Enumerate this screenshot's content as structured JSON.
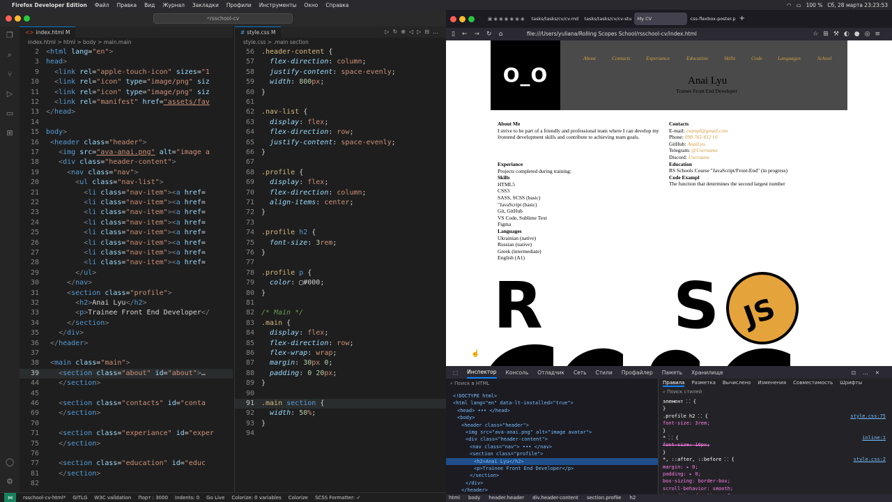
{
  "menubar": {
    "app": "Firefox Developer Edition",
    "items": [
      "Файл",
      "Правка",
      "Вид",
      "Журнал",
      "Закладки",
      "Профили",
      "Инструменты",
      "Окно",
      "Справка"
    ],
    "status_right": [
      "100 %",
      "Сб, 28 марта  23:23:53"
    ]
  },
  "vscode": {
    "search": "rsschool-cv",
    "left_tab": "index.html M",
    "left_crumbs": "index.html > html > body > main.main",
    "right_tab": "style.css M",
    "right_crumbs": "style.css > .main section",
    "html_lines": [
      {
        "n": "2",
        "html": "<span class='p'>&lt;</span><span class='t'>html</span> <span class='a'>lang</span><span class='w'>=</span><span class='s'>\"en\"</span><span class='p'>&gt;</span>"
      },
      {
        "n": "3",
        "html": "<span class='t'>head</span><span class='p'>&gt;</span>"
      },
      {
        "n": "9",
        "html": "  <span class='p'>&lt;</span><span class='t'>link</span> <span class='a'>rel</span><span class='w'>=</span><span class='s'>\"apple-touch-icon\"</span> <span class='a'>sizes</span><span class='w'>=</span><span class='s'>\"1</span>"
      },
      {
        "n": "10",
        "html": "  <span class='p'>&lt;</span><span class='t'>link</span> <span class='a'>rel</span><span class='w'>=</span><span class='s'>\"icon\"</span> <span class='a'>type</span><span class='w'>=</span><span class='s'>\"image/png\"</span> <span class='a'>siz</span>"
      },
      {
        "n": "11",
        "html": "  <span class='p'>&lt;</span><span class='t'>link</span> <span class='a'>rel</span><span class='w'>=</span><span class='s'>\"icon\"</span> <span class='a'>type</span><span class='w'>=</span><span class='s'>\"image/png\"</span> <span class='a'>siz</span>"
      },
      {
        "n": "12",
        "html": "  <span class='p'>&lt;</span><span class='t'>link</span> <span class='a'>rel</span><span class='w'>=</span><span class='s'>\"manifest\"</span> <span class='a'>href</span><span class='w'>=</span><span class='u'>\"assets/fav</span>"
      },
      {
        "n": "13",
        "html": "<span class='p'>&lt;/</span><span class='t'>head</span><span class='p'>&gt;</span>"
      },
      {
        "n": "14",
        "html": ""
      },
      {
        "n": "15",
        "html": "<span class='t'>body</span><span class='p'>&gt;</span>"
      },
      {
        "n": "16",
        "html": " <span class='p'>&lt;</span><span class='t'>header</span> <span class='a'>class</span><span class='w'>=</span><span class='s'>\"header\"</span><span class='p'>&gt;</span>"
      },
      {
        "n": "17",
        "html": "   <span class='p'>&lt;</span><span class='t'>img</span> <span class='a'>src</span><span class='w'>=</span><span class='u'>\"ava-anai.png\"</span> <span class='a'>alt</span><span class='w'>=</span><span class='s'>\"image a</span>"
      },
      {
        "n": "18",
        "html": "   <span class='p'>&lt;</span><span class='t'>div</span> <span class='a'>class</span><span class='w'>=</span><span class='s'>\"header-content\"</span><span class='p'>&gt;</span>"
      },
      {
        "n": "19",
        "html": "     <span class='p'>&lt;</span><span class='t'>nav</span> <span class='a'>class</span><span class='w'>=</span><span class='s'>\"nav\"</span><span class='p'>&gt;</span>"
      },
      {
        "n": "20",
        "html": "       <span class='p'>&lt;</span><span class='t'>ul</span> <span class='a'>class</span><span class='w'>=</span><span class='s'>\"nav-list\"</span><span class='p'>&gt;</span>"
      },
      {
        "n": "21",
        "html": "         <span class='p'>&lt;</span><span class='t'>li</span> <span class='a'>class</span><span class='w'>=</span><span class='s'>\"nav-item\"</span><span class='p'>&gt;&lt;</span><span class='t'>a</span> <span class='a'>href</span><span class='w'>=</span>"
      },
      {
        "n": "22",
        "html": "         <span class='p'>&lt;</span><span class='t'>li</span> <span class='a'>class</span><span class='w'>=</span><span class='s'>\"nav-item\"</span><span class='p'>&gt;&lt;</span><span class='t'>a</span> <span class='a'>href</span><span class='w'>=</span>"
      },
      {
        "n": "23",
        "html": "         <span class='p'>&lt;</span><span class='t'>li</span> <span class='a'>class</span><span class='w'>=</span><span class='s'>\"nav-item\"</span><span class='p'>&gt;&lt;</span><span class='t'>a</span> <span class='a'>href</span><span class='w'>=</span>"
      },
      {
        "n": "24",
        "html": "         <span class='p'>&lt;</span><span class='t'>li</span> <span class='a'>class</span><span class='w'>=</span><span class='s'>\"nav-item\"</span><span class='p'>&gt;&lt;</span><span class='t'>a</span> <span class='a'>href</span><span class='w'>=</span>"
      },
      {
        "n": "25",
        "html": "         <span class='p'>&lt;</span><span class='t'>li</span> <span class='a'>class</span><span class='w'>=</span><span class='s'>\"nav-item\"</span><span class='p'>&gt;&lt;</span><span class='t'>a</span> <span class='a'>href</span><span class='w'>=</span>"
      },
      {
        "n": "26",
        "html": "         <span class='p'>&lt;</span><span class='t'>li</span> <span class='a'>class</span><span class='w'>=</span><span class='s'>\"nav-item\"</span><span class='p'>&gt;&lt;</span><span class='t'>a</span> <span class='a'>href</span><span class='w'>=</span>"
      },
      {
        "n": "27",
        "html": "         <span class='p'>&lt;</span><span class='t'>li</span> <span class='a'>class</span><span class='w'>=</span><span class='s'>\"nav-item\"</span><span class='p'>&gt;&lt;</span><span class='t'>a</span> <span class='a'>href</span><span class='w'>=</span>"
      },
      {
        "n": "28",
        "html": "         <span class='p'>&lt;</span><span class='t'>li</span> <span class='a'>class</span><span class='w'>=</span><span class='s'>\"nav-item\"</span><span class='p'>&gt;&lt;</span><span class='t'>a</span> <span class='a'>href</span><span class='w'>=</span>"
      },
      {
        "n": "29",
        "html": "       <span class='p'>&lt;/</span><span class='t'>ul</span><span class='p'>&gt;</span>"
      },
      {
        "n": "30",
        "html": "     <span class='p'>&lt;/</span><span class='t'>nav</span><span class='p'>&gt;</span>"
      },
      {
        "n": "31",
        "html": "     <span class='p'>&lt;</span><span class='t'>section</span> <span class='a'>class</span><span class='w'>=</span><span class='s'>\"profile\"</span><span class='p'>&gt;</span>"
      },
      {
        "n": "32",
        "html": "       <span class='p'>&lt;</span><span class='t'>h2</span><span class='p'>&gt;</span><span class='w'>Anai Lyu</span><span class='p'>&lt;/</span><span class='t'>h2</span><span class='p'>&gt;</span>"
      },
      {
        "n": "33",
        "html": "       <span class='p'>&lt;</span><span class='t'>p</span><span class='p'>&gt;</span><span class='w'>Trainee Front End Developer</span><span class='p'>&lt;/</span>"
      },
      {
        "n": "34",
        "html": "     <span class='p'>&lt;/</span><span class='t'>section</span><span class='p'>&gt;</span>"
      },
      {
        "n": "35",
        "html": "   <span class='p'>&lt;/</span><span class='t'>div</span><span class='p'>&gt;</span>"
      },
      {
        "n": "36",
        "html": " <span class='p'>&lt;/</span><span class='t'>header</span><span class='p'>&gt;</span>"
      },
      {
        "n": "37",
        "html": ""
      },
      {
        "n": "38",
        "html": " <span class='p'>&lt;</span><span class='t'>main</span> <span class='a'>class</span><span class='w'>=</span><span class='s'>\"main\"</span><span class='p'>&gt;</span>"
      },
      {
        "n": "39",
        "html": "   <span class='p'>&lt;</span><span class='t'>section</span> <span class='a'>class</span><span class='w'>=</span><span class='s'>\"about\"</span> <span class='a'>id</span><span class='w'>=</span><span class='s'>\"about\"</span><span class='p'>&gt;</span><span class='w'>…</span>"
      },
      {
        "n": "44",
        "html": "   <span class='p'>&lt;/</span><span class='t'>section</span><span class='p'>&gt;</span>"
      },
      {
        "n": "45",
        "html": ""
      },
      {
        "n": "46",
        "html": "   <span class='p'>&lt;</span><span class='t'>section</span> <span class='a'>class</span><span class='w'>=</span><span class='s'>\"contacts\"</span> <span class='a'>id</span><span class='w'>=</span><span class='s'>\"conta</span>"
      },
      {
        "n": "69",
        "html": "   <span class='p'>&lt;/</span><span class='t'>section</span><span class='p'>&gt;</span>"
      },
      {
        "n": "70",
        "html": ""
      },
      {
        "n": "71",
        "html": "   <span class='p'>&lt;</span><span class='t'>section</span> <span class='a'>class</span><span class='w'>=</span><span class='s'>\"experiance\"</span> <span class='a'>id</span><span class='w'>=</span><span class='s'>\"exper</span>"
      },
      {
        "n": "75",
        "html": "   <span class='p'>&lt;/</span><span class='t'>section</span><span class='p'>&gt;</span>"
      },
      {
        "n": "76",
        "html": ""
      },
      {
        "n": "77",
        "html": "   <span class='p'>&lt;</span><span class='t'>section</span> <span class='a'>class</span><span class='w'>=</span><span class='s'>\"education\"</span> <span class='a'>id</span><span class='w'>=</span><span class='s'>\"educ</span>"
      },
      {
        "n": "81",
        "html": "   <span class='p'>&lt;/</span><span class='t'>section</span><span class='p'>&gt;</span>"
      },
      {
        "n": "82",
        "html": ""
      }
    ],
    "css_lines": [
      {
        "n": "56",
        "html": "<span class='y'>.header-content</span> <span class='w'>{</span>"
      },
      {
        "n": "57",
        "html": "  <span class='pr'>flex-direction</span><span class='w'>: </span><span class='k'>column</span><span class='w'>;</span>"
      },
      {
        "n": "58",
        "html": "  <span class='pr'>justify-content</span><span class='w'>: </span><span class='k'>space-evenly</span><span class='w'>;</span>"
      },
      {
        "n": "59",
        "html": "  <span class='pr'>width</span><span class='w'>: </span><span class='v'>800</span><span class='k'>px</span><span class='w'>;</span>"
      },
      {
        "n": "60",
        "html": "<span class='w'>}</span>"
      },
      {
        "n": "61",
        "html": ""
      },
      {
        "n": "62",
        "html": "<span class='y'>.nav-list</span> <span class='w'>{</span>"
      },
      {
        "n": "63",
        "html": "  <span class='pr'>display</span><span class='w'>: </span><span class='k'>flex</span><span class='w'>;</span>"
      },
      {
        "n": "64",
        "html": "  <span class='pr'>flex-direction</span><span class='w'>: </span><span class='k'>row</span><span class='w'>;</span>"
      },
      {
        "n": "65",
        "html": "  <span class='pr'>justify-content</span><span class='w'>: </span><span class='k'>space-evenly</span><span class='w'>;</span>"
      },
      {
        "n": "66",
        "html": "<span class='w'>}</span>"
      },
      {
        "n": "67",
        "html": ""
      },
      {
        "n": "68",
        "html": "<span class='y'>.profile</span> <span class='w'>{</span>"
      },
      {
        "n": "69",
        "html": "  <span class='pr'>display</span><span class='w'>: </span><span class='k'>flex</span><span class='w'>;</span>"
      },
      {
        "n": "70",
        "html": "  <span class='pr'>flex-direction</span><span class='w'>: </span><span class='k'>column</span><span class='w'>;</span>"
      },
      {
        "n": "71",
        "html": "  <span class='pr'>align-items</span><span class='w'>: </span><span class='k'>center</span><span class='w'>;</span>"
      },
      {
        "n": "72",
        "html": "<span class='w'>}</span>"
      },
      {
        "n": "73",
        "html": ""
      },
      {
        "n": "74",
        "html": "<span class='y'>.profile</span> <span class='t'>h2</span> <span class='w'>{</span>"
      },
      {
        "n": "75",
        "html": "  <span class='pr'>font-size</span><span class='w'>: </span><span class='v'>3</span><span class='k'>rem</span><span class='w'>;</span>"
      },
      {
        "n": "76",
        "html": "<span class='w'>}</span>"
      },
      {
        "n": "77",
        "html": ""
      },
      {
        "n": "78",
        "html": "<span class='y'>.profile</span> <span class='t'>p</span> <span class='w'>{</span>"
      },
      {
        "n": "79",
        "html": "  <span class='pr'>color</span><span class='w'>: ▢</span><span class='w'>#000</span><span class='w'>;</span>"
      },
      {
        "n": "80",
        "html": "<span class='w'>}</span>"
      },
      {
        "n": "81",
        "html": ""
      },
      {
        "n": "82",
        "html": "<span class='cm'>/* Main */</span>"
      },
      {
        "n": "83",
        "html": "<span class='y'>.main</span> <span class='w'>{</span>"
      },
      {
        "n": "84",
        "html": "  <span class='pr'>display</span><span class='w'>: </span><span class='k'>flex</span><span class='w'>;</span>"
      },
      {
        "n": "85",
        "html": "  <span class='pr'>flex-direction</span><span class='w'>: </span><span class='k'>row</span><span class='w'>;</span>"
      },
      {
        "n": "86",
        "html": "  <span class='pr'>flex-wrap</span><span class='w'>: </span><span class='k'>wrap</span><span class='w'>;</span>"
      },
      {
        "n": "87",
        "html": "  <span class='pr'>margin</span><span class='w'>: </span><span class='v'>30</span><span class='k'>px</span> <span class='v'>0</span><span class='w'>;</span>"
      },
      {
        "n": "88",
        "html": "  <span class='pr'>padding</span><span class='w'>: </span><span class='v'>0</span> <span class='v'>20</span><span class='k'>px</span><span class='w'>;</span>"
      },
      {
        "n": "89",
        "html": "<span class='w'>}</span>"
      },
      {
        "n": "90",
        "html": ""
      },
      {
        "n": "91",
        "html": "<span class='y'>.main</span> <span class='t'>section</span> <span class='w'>{</span>"
      },
      {
        "n": "92",
        "html": "  <span class='pr'>width</span><span class='w'>: </span><span class='v'>50</span><span class='k'>%</span><span class='w'>;</span>"
      },
      {
        "n": "93",
        "html": "<span class='w'>}</span>"
      },
      {
        "n": "94",
        "html": ""
      }
    ],
    "status": [
      "rsschool-cv-html*",
      "GITLG",
      "W3C validation",
      "Порт : 3000",
      "Indents: 0",
      "Go Live",
      "Colorize: 0 variables",
      "Colorize",
      "SCSS Formatter: ✓"
    ]
  },
  "firefox": {
    "tabs": [
      "tasks/tasks/cv/cv.md",
      "tasks/tasks/cv/cv-stu",
      "My CV",
      "css-flexbox-poster.p"
    ],
    "url": "file:///Users/yuliana/Rolling Scopes School/rsschool-cv/index.html",
    "cv": {
      "avatar_text": "O_O",
      "nav": [
        "About",
        "Contacts",
        "Experiance",
        "Education",
        "Skills",
        "Code",
        "Languages",
        "School"
      ],
      "name": "Anai Lyu",
      "role": "Trainee Front End Developer",
      "about_title": "About Me",
      "about_text": "I strive to be part of a friendly and professional team where I can develop my frontend development skills and contribute to achieving team goals.",
      "contacts_title": "Contacts",
      "email_label": "E-mail:",
      "email": "exampl@gmail.com",
      "phone_label": "Phone:",
      "phone": "098 765 432 10",
      "github_label": "GitHub:",
      "github": "AnaiLyu",
      "telegram_label": "Telegram:",
      "telegram": "@Username",
      "discord_label": "Discord:",
      "discord": "Username",
      "exp_title": "Experiance",
      "exp_text": "Projects completed during training:",
      "edu_title": "Education",
      "edu_text": "RS Schools Course \"JavaScript/Front-End\" (in progress)",
      "code_title": "Code Exampl",
      "code_text": "The function that determines the second largest number",
      "skills_title": "Skills",
      "skills": [
        "HTML5",
        "CSS3",
        "SASS, SCSS (basic)",
        "\"JavaScript (basic)",
        "Git, GitHub",
        "VS Code, Sublime Text",
        "Figma"
      ],
      "lang_title": "Languages",
      "languages": [
        "Ukrainian (native)",
        "Russian (native)",
        "Greek (intermediate)",
        "English (A1)"
      ],
      "logo_letters": [
        "R",
        "S",
        "JS"
      ]
    }
  },
  "devtools": {
    "tabs": [
      "Инспектор",
      "Консоль",
      "Отладчик",
      "Сеть",
      "Стили",
      "Профайлер",
      "Память",
      "Хранилище"
    ],
    "search_placeholder": "Поиск в HTML",
    "right_tabs": [
      "Правила",
      "Разметка",
      "Вычислено",
      "Изменения",
      "Совместимость",
      "Шрифты"
    ],
    "filter_placeholder": "Поиск стилей",
    "tree": [
      "<!DOCTYPE html>",
      "<html lang=\"en\" data-lt-installed=\"true\">",
      "<head> ••• </head>",
      "<body>",
      "<header class=\"header\">",
      "<img src=\"ava-anai.png\" alt=\"image avatar\">",
      "<div class=\"header-content\">",
      "<nav class=\"nav\"> ••• </nav>",
      "<section class=\"profile\">",
      "<h2>Anai Lyu</h2>",
      "<p>Trainee Front End Developer</p>",
      "</section>",
      "</div>",
      "</header>"
    ],
    "rules": [
      {
        "text": "элемент ⸬ {",
        "file": ""
      },
      {
        "text": "}",
        "file": ""
      },
      {
        "text": ".profile h2 ⸬ {",
        "file": "style.css:75"
      },
      {
        "text": "  font-size: 3rem;",
        "file": ""
      },
      {
        "text": "}",
        "file": ""
      },
      {
        "text": "* ⸬ {",
        "file": "inline:1"
      },
      {
        "text": "  font-size: 16px;",
        "file": ""
      },
      {
        "text": "}",
        "file": ""
      },
      {
        "text": "*, ::after, ::before ⸬ {",
        "file": "style.css:2"
      },
      {
        "text": "  margin: ▸ 0;",
        "file": ""
      },
      {
        "text": "  padding: ▸ 0;",
        "file": ""
      },
      {
        "text": "  box-sizing: border-box;",
        "file": ""
      },
      {
        "text": "  scroll-behavior: smooth;",
        "file": ""
      },
      {
        "text": "  transition-duration: .3s;",
        "file": ""
      }
    ],
    "breadcrumbs": [
      "html",
      "body",
      "header.header",
      "div.header-content",
      "section.profile",
      "h2"
    ]
  }
}
